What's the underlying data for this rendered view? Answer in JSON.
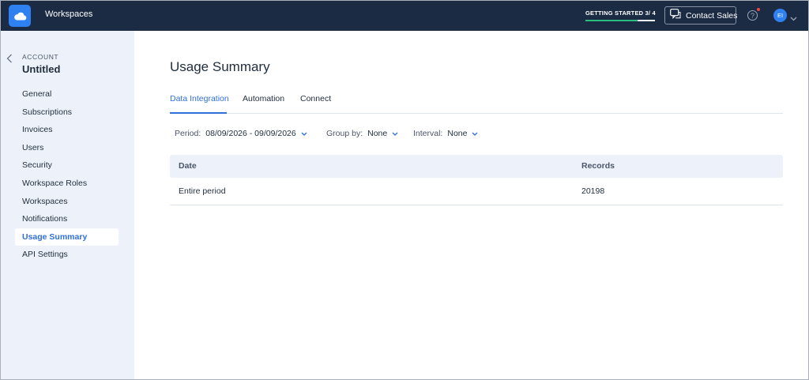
{
  "topbar": {
    "app_title": "Workspaces",
    "getting_started": {
      "label": "GETTING STARTED 3/ 4",
      "progress": 0.75
    },
    "contact_sales": "Contact Sales",
    "help_glyph": "?",
    "avatar_initials": "EI"
  },
  "sidebar": {
    "section_label": "ACCOUNT",
    "account_name": "Untitled",
    "items": [
      {
        "label": "General"
      },
      {
        "label": "Subscriptions"
      },
      {
        "label": "Invoices"
      },
      {
        "label": "Users"
      },
      {
        "label": "Security"
      },
      {
        "label": "Workspace Roles"
      },
      {
        "label": "Workspaces"
      },
      {
        "label": "Notifications"
      },
      {
        "label": "Usage Summary"
      },
      {
        "label": "API Settings"
      }
    ],
    "active_index": 8
  },
  "main": {
    "title": "Usage Summary",
    "tabs": [
      {
        "label": "Data Integration"
      },
      {
        "label": "Automation"
      },
      {
        "label": "Connect"
      }
    ],
    "filters": {
      "period_label": "Period:",
      "period_value": "08/09/2026 - 09/09/2026",
      "group_label": "Group by:",
      "group_value": "None",
      "interval_label": "Interval:",
      "interval_value": "None"
    },
    "table": {
      "headers": [
        "Date",
        "Records"
      ],
      "rows": [
        [
          "Entire period",
          "20198"
        ]
      ]
    }
  },
  "colors": {
    "topbar_bg": "#1b2b44",
    "accent": "#2f80f0",
    "link_blue": "#2f6fdc",
    "sidebar_bg": "#edf2fa",
    "progress_green": "#2dbd7e"
  },
  "icons": {
    "logo": "cloud-icon",
    "back": "chevron-left-icon",
    "contact": "chat-icon",
    "help": "help-icon",
    "avatar_caret": "chevron-down-icon",
    "filter_caret": "chevron-down-icon"
  }
}
